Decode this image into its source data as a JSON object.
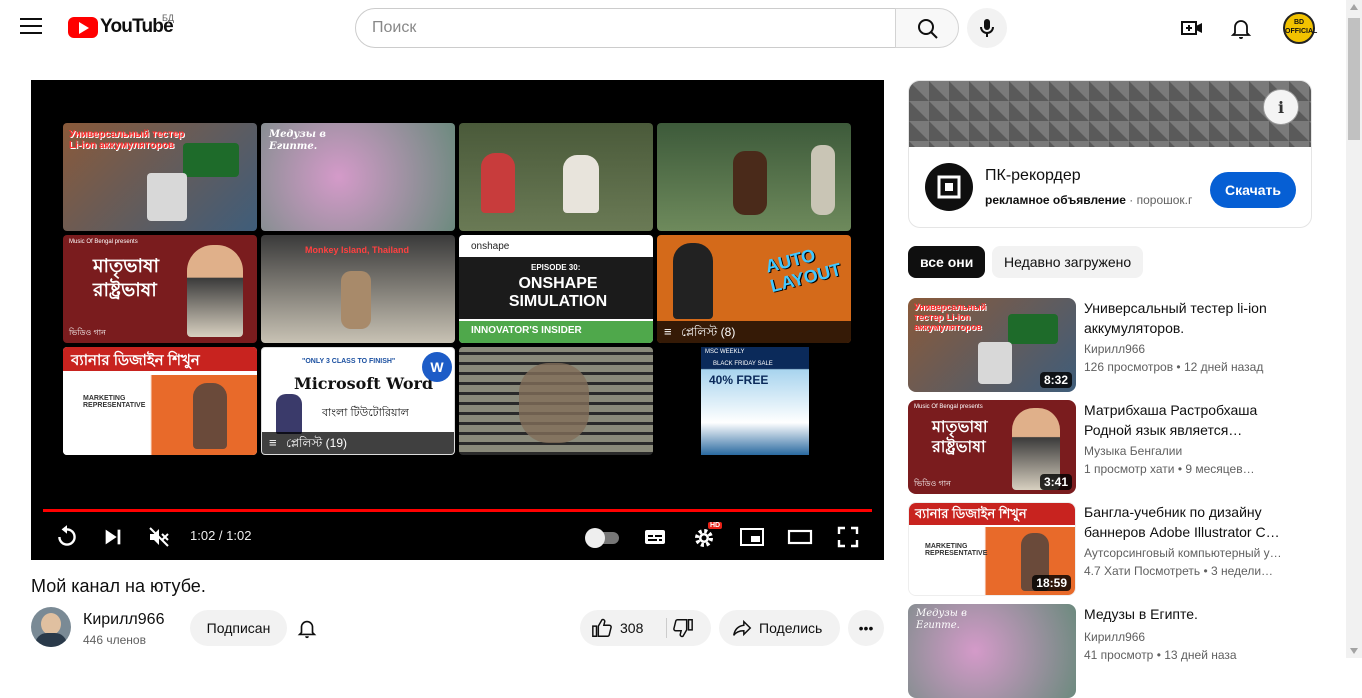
{
  "header": {
    "logo_text": "YouTube",
    "country_code": "БД",
    "search_placeholder": "Поиск",
    "avatar_label": "BD OFFICIAL"
  },
  "player": {
    "time": "1:02 / 1:02",
    "progress": 1.0,
    "hd_badge": "HD",
    "endscreen": {
      "tile1_text": "Универсальный тестер Li-ion аккумуляторов",
      "tile2_text": "Медузы в Египте.",
      "tile5_text": "মাতৃভাষা রাষ্ট্রভাষা",
      "tile5_top": "Music Of Bengal presents",
      "tile5_bottom": "ভিডিও গান",
      "tile6_text": "Monkey Island, Thailand",
      "tile7_brand": "onshape",
      "tile7_episode": "EPISODE 30:",
      "tile7_title": "ONSHAPE SIMULATION",
      "tile7_footer": "INNOVATOR'S INSIDER",
      "tile8_text": "AUTO LAYOUT",
      "tile8_badge": "প্লেলিস্ট (8)",
      "tile9_text": "ব্যানার ডিজাইন শিখুন",
      "tile9_sub": "MARKETING REPRESENTATIVE",
      "tile10_top": "\"ONLY 3 CLASS TO FINISH\"",
      "tile10_title": "Microsoft Word",
      "tile10_sub": "বাংলা টিউটোরিয়াল",
      "tile10_badge": "প্লেলিস্ট (19)",
      "tile12_top": "MSC WEEKLY",
      "tile12_sale": "BLACK FRIDAY SALE",
      "tile12_offer": "40% FREE"
    }
  },
  "video": {
    "title": "Мой канал на ютубе.",
    "channel": "Кирилл966",
    "subscribers": "446 членов",
    "subscribe_label": "Подписан",
    "likes": "308",
    "share_label": "Поделись",
    "more_label": "•••"
  },
  "ad": {
    "title": "ПК-рекордер",
    "label": "рекламное объявление",
    "separator": "·",
    "domain": "порошок.г",
    "cta": "Скачать"
  },
  "chips": {
    "all": "все они",
    "recent": "Недавно загружено"
  },
  "recommendations": [
    {
      "title": "Универсальный тестер li-ion аккумуляторов.",
      "channel": "Кирилл966",
      "views": "126 просмотров",
      "age": "12 дней назад",
      "duration": "8:32"
    },
    {
      "title": "Матрибхаша Растробхаша Родной язык является…",
      "channel": "Музыка Бенгалии",
      "views": "1 просмотр хати",
      "age": "9 месяцев…",
      "duration": "3:41"
    },
    {
      "title": "Бангла-учебник по дизайну баннеров Adobe Illustrator C…",
      "channel": "Аутсорсинговый компьютерный у…",
      "views": "4.7 Хати Посмотреть",
      "age": "3 недели…",
      "duration": "18:59"
    },
    {
      "title": "Медузы в Египте.",
      "channel": "Кирилл966",
      "views": "41 просмотр",
      "age": "13 дней наза",
      "duration": ""
    }
  ],
  "colors": {
    "brand_red": "#ff0000",
    "cta_blue": "#065fd4",
    "chip_active": "#0f0f0f",
    "chip_inactive": "#f2f2f2"
  }
}
